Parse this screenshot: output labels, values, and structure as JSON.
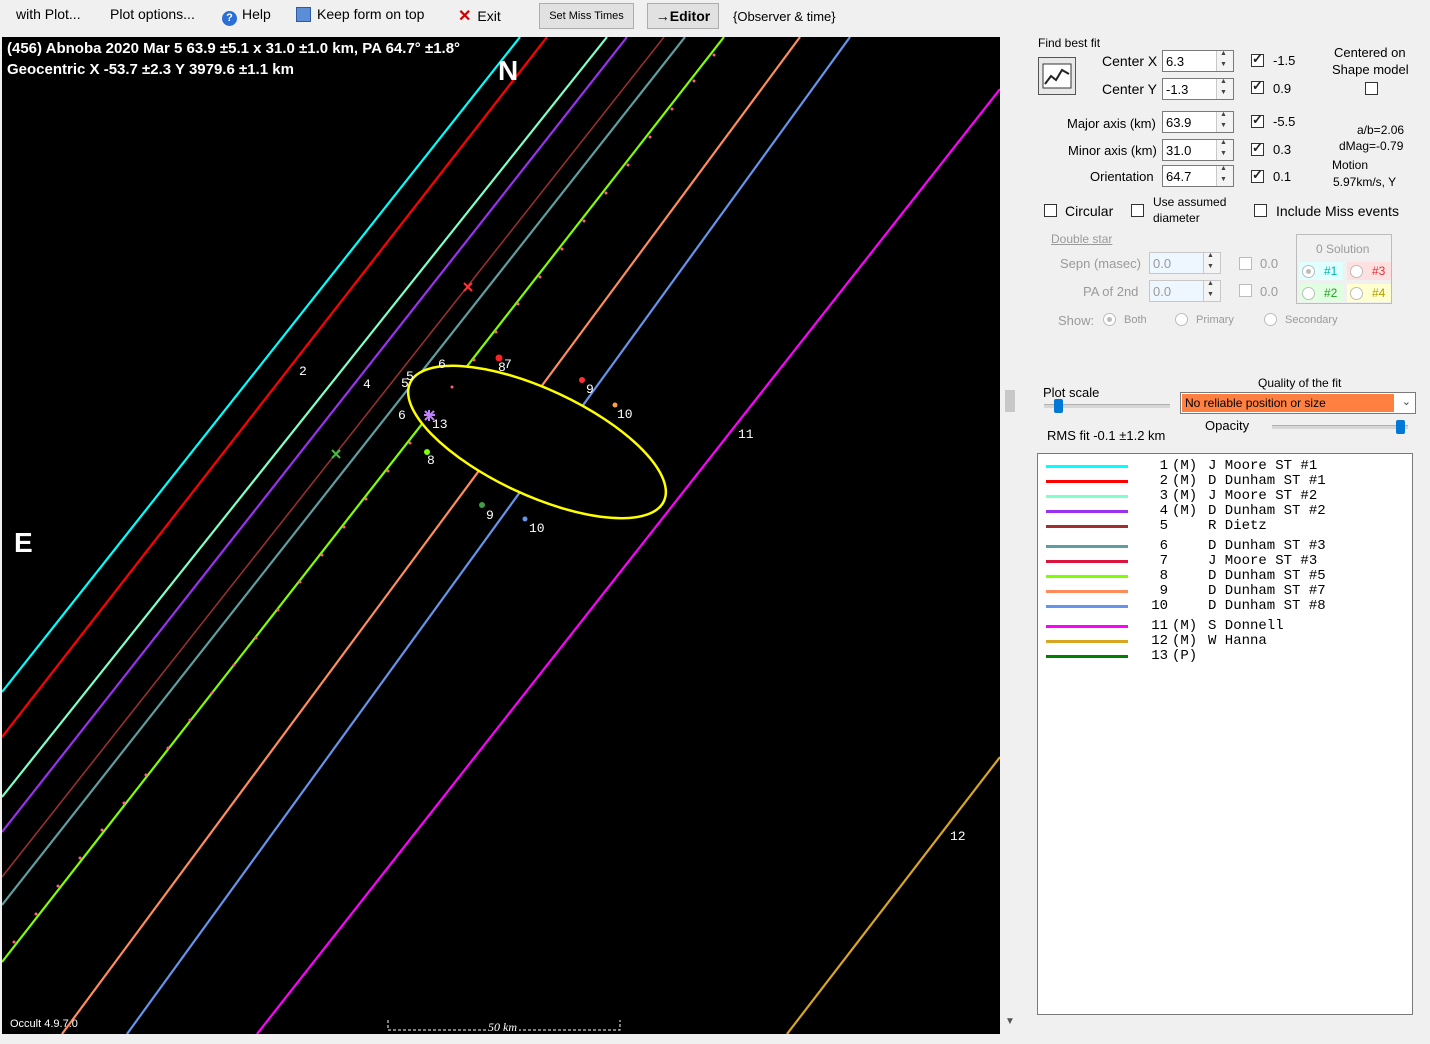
{
  "menu": {
    "with_plot": "with Plot...",
    "plot_options": "Plot options...",
    "help": "Help",
    "keep_on_top": "Keep form on top",
    "exit": "Exit",
    "set_miss_times": "Set Miss Times",
    "editor": "→Editor",
    "observer_time": "{Observer & time}"
  },
  "plot": {
    "title_line1": "(456) Abnoba  2020 Mar 5   63.9 ±5.1 x 31.0 ±1.0 km, PA 64.7° ±1.8°",
    "title_line2": "Geocentric  X  -53.7 ±2.3  Y 3979.6 ±1.1 km",
    "north": "N",
    "east": "E",
    "version": "Occult 4.9.7.0",
    "scale": "50 km",
    "chord_labels": [
      "2",
      "4",
      "5",
      "5",
      "6",
      "6",
      "8",
      "7",
      "8",
      "9",
      "9",
      "10",
      "10",
      "11",
      "12",
      "13"
    ]
  },
  "panel": {
    "find_best_fit": "Find best fit",
    "center_x_label": "Center X",
    "center_x": "6.3",
    "center_x_delta": "-1.5",
    "center_y_label": "Center Y",
    "center_y": "-1.3",
    "center_y_delta": "0.9",
    "centered_on": "Centered on",
    "shape_model": "Shape model",
    "major_label": "Major axis (km)",
    "major": "63.9",
    "major_delta": "-5.5",
    "minor_label": "Minor axis (km)",
    "minor": "31.0",
    "minor_delta": "0.3",
    "orient_label": "Orientation",
    "orient": "64.7",
    "orient_delta": "0.1",
    "ab_ratio": "a/b=2.06",
    "dmag": "dMag=-0.79",
    "motion_label": "Motion",
    "motion": "5.97km/s, Y",
    "circular": "Circular",
    "use_assumed_1": "Use assumed",
    "use_assumed_2": "diameter",
    "include_miss": "Include Miss events",
    "double_star": "Double star",
    "sepn_label": "Sepn (masec)",
    "sepn": "0.0",
    "sepn_extra": "0.0",
    "pa2_label": "PA of 2nd",
    "pa2": "0.0",
    "pa2_extra": "0.0",
    "show_label": "Show:",
    "show_both": "Both",
    "show_primary": "Primary",
    "show_secondary": "Secondary",
    "solution_title": "0 Solution",
    "sol1": "#1",
    "sol2": "#2",
    "sol3": "#3",
    "sol4": "#4",
    "plot_scale": "Plot scale",
    "quality_label": "Quality of the fit",
    "quality_value": "No reliable position or size",
    "opacity": "Opacity",
    "rms_fit": "RMS fit -0.1 ±1.2 km"
  },
  "legend": [
    {
      "num": "1",
      "flag": "(M)",
      "observer": "J Moore ST #1",
      "color": "#00ffff"
    },
    {
      "num": "2",
      "flag": "(M)",
      "observer": "D Dunham ST #1",
      "color": "#ff0000"
    },
    {
      "num": "3",
      "flag": "(M)",
      "observer": "J Moore ST #2",
      "color": "#80ffc8"
    },
    {
      "num": "4",
      "flag": "(M)",
      "observer": "D Dunham ST #2",
      "color": "#9b30f0"
    },
    {
      "num": "5",
      "flag": "",
      "observer": "R Dietz",
      "color": "#a03030"
    },
    {
      "num": "6",
      "flag": "",
      "observer": "D Dunham ST #3",
      "color": "#5f9ea0"
    },
    {
      "num": "7",
      "flag": "",
      "observer": "J Moore ST #3",
      "color": "#dc143c"
    },
    {
      "num": "8",
      "flag": "",
      "observer": "D Dunham ST #5",
      "color": "#80ff00"
    },
    {
      "num": "9",
      "flag": "",
      "observer": "D Dunham ST #7",
      "color": "#ff8c5a"
    },
    {
      "num": "10",
      "flag": "",
      "observer": "D Dunham ST #8",
      "color": "#6495ed"
    },
    {
      "num": "11",
      "flag": "(M)",
      "observer": "S Donnell",
      "color": "#ff00ff"
    },
    {
      "num": "12",
      "flag": "(M)",
      "observer": "W Hanna",
      "color": "#daa520"
    },
    {
      "num": "13",
      "flag": "(P)",
      "observer": "",
      "color": "#008000"
    }
  ]
}
